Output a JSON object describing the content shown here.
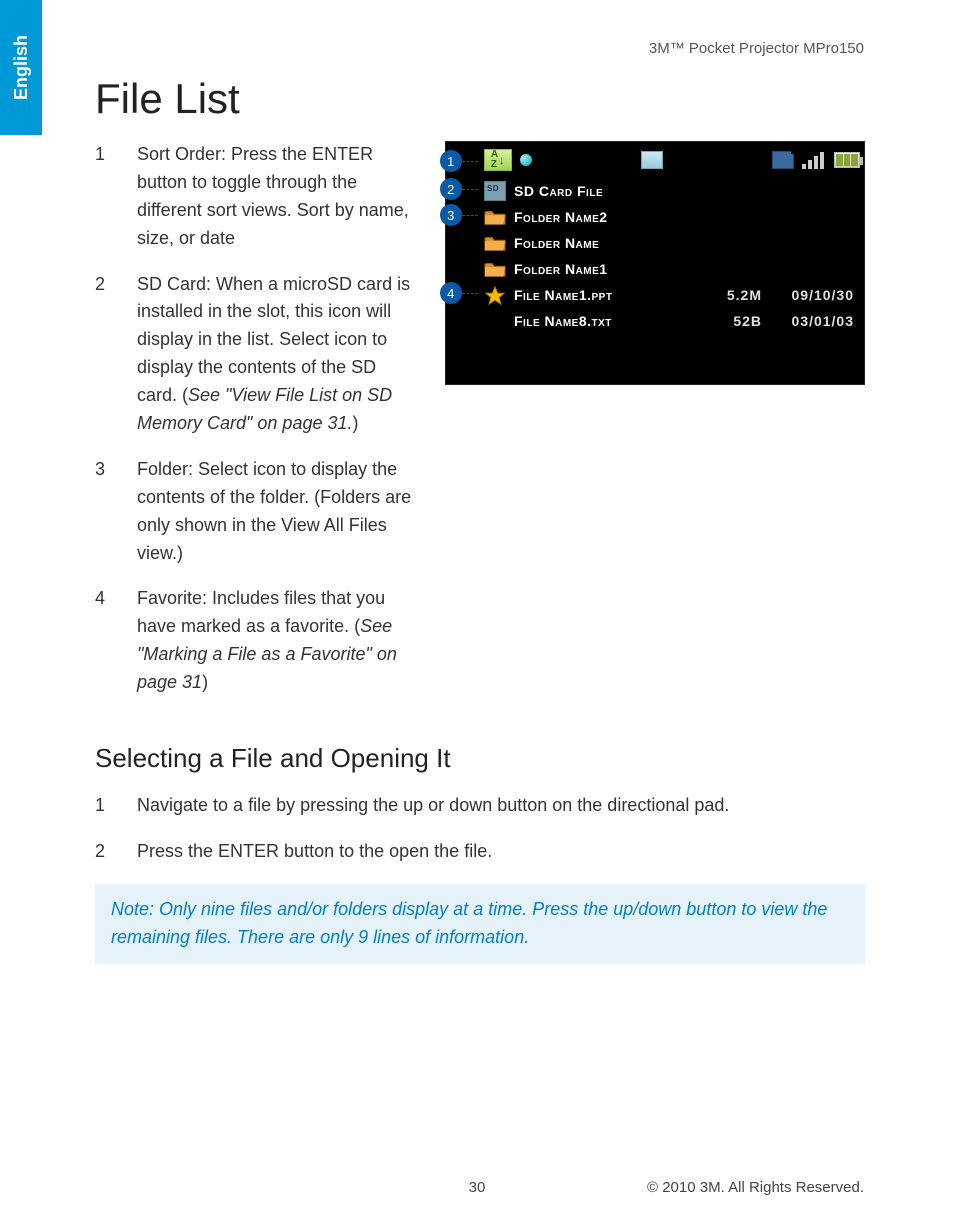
{
  "language_tab": "English",
  "header_product": "3M™ Pocket Projector MPro150",
  "title": "File List",
  "list_items": [
    {
      "num": "1",
      "text_plain": "Sort Order: Press the ENTER button to toggle through the different sort views. Sort by name, size, or date"
    },
    {
      "num": "2",
      "text_plain": "SD Card: When a microSD card is installed in the slot, this icon will display in the list. Select icon to display the contents of the SD card. (",
      "italic": "See \"View File List on SD Memory Card\" on page 31.",
      "after": ")"
    },
    {
      "num": "3",
      "text_plain": "Folder: Select icon to display the contents of the folder. (Folders are only shown in the View All Files view.)"
    },
    {
      "num": "4",
      "text_plain": "Favorite: Includes files that you have marked as a favorite. (",
      "italic": "See \"Marking a File as a Favorite\" on page 31",
      "after": ")"
    }
  ],
  "subheading": "Selecting a File and Opening It",
  "steps": [
    {
      "num": "1",
      "text": "Navigate to a file by pressing the up or down button on the directional pad."
    },
    {
      "num": "2",
      "text": "Press the ENTER button to the open the file."
    }
  ],
  "note": "Note: Only nine files and/or folders display at a time. Press the up/down button to view the remaining files. There are only 9 lines of information.",
  "page_number": "30",
  "copyright": "© 2010 3M. All Rights Reserved.",
  "device": {
    "sort_label": "A↓Z",
    "rows": [
      {
        "icon": "sd",
        "name": "SD Card File",
        "size": "",
        "date": ""
      },
      {
        "icon": "folder",
        "name": "Folder Name2",
        "size": "",
        "date": ""
      },
      {
        "icon": "folder",
        "name": "Folder Name",
        "size": "",
        "date": ""
      },
      {
        "icon": "folder",
        "name": "Folder Name1",
        "size": "",
        "date": ""
      },
      {
        "icon": "star",
        "name": "File Name1.ppt",
        "size": "5.2M",
        "date": "09/10/30"
      },
      {
        "icon": "none",
        "name": "File Name8.txt",
        "size": "52B",
        "date": "03/01/03"
      }
    ],
    "callouts": [
      "1",
      "2",
      "3",
      "4"
    ]
  }
}
